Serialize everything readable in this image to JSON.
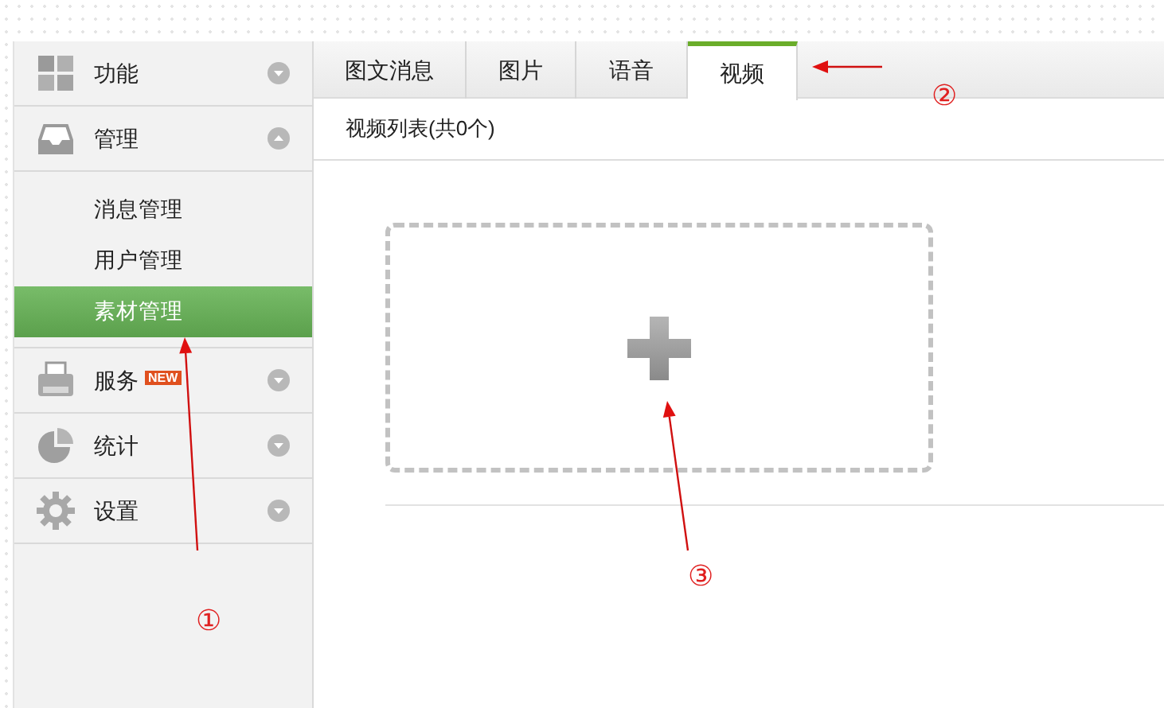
{
  "sidebar": {
    "groups": [
      {
        "label": "功能",
        "expanded": false
      },
      {
        "label": "管理",
        "expanded": true,
        "children": [
          {
            "label": "消息管理",
            "selected": false
          },
          {
            "label": "用户管理",
            "selected": false
          },
          {
            "label": "素材管理",
            "selected": true
          }
        ]
      },
      {
        "label": "服务",
        "expanded": false,
        "badge": "NEW"
      },
      {
        "label": "统计",
        "expanded": false
      },
      {
        "label": "设置",
        "expanded": false
      }
    ]
  },
  "tabs": [
    {
      "label": "图文消息",
      "selected": false
    },
    {
      "label": "图片",
      "selected": false
    },
    {
      "label": "语音",
      "selected": false
    },
    {
      "label": "视频",
      "selected": true
    }
  ],
  "list_header": "视频列表(共0个)",
  "annotations": [
    {
      "label": "①"
    },
    {
      "label": "②"
    },
    {
      "label": "③"
    }
  ]
}
